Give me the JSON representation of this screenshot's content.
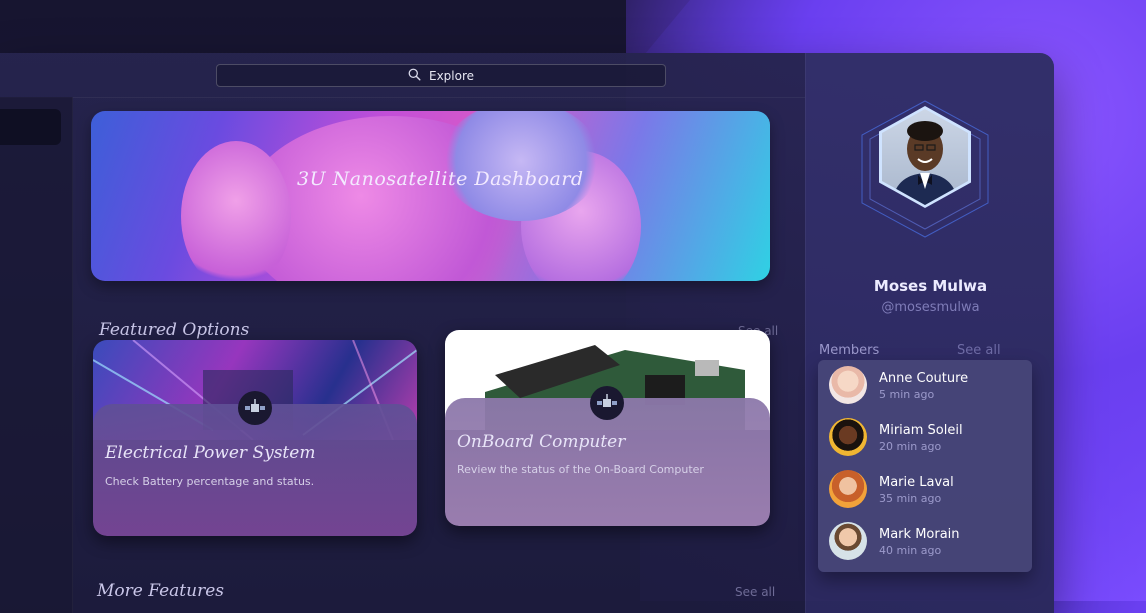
{
  "search": {
    "label": "Explore"
  },
  "hero": {
    "title": "3U Nanosatellite Dashboard"
  },
  "featured": {
    "title": "Featured Options",
    "see_all": "See all",
    "cards": [
      {
        "title": "Electrical Power System",
        "subtitle": "Check Battery percentage and status.",
        "icon": "satellite-icon"
      },
      {
        "title": "OnBoard Computer",
        "subtitle": "Review the status of the On-Board Computer",
        "icon": "satellite-icon"
      }
    ]
  },
  "more": {
    "title": "More Features",
    "see_all": "See all"
  },
  "profile": {
    "name": "Moses Mulwa",
    "handle": "@mosesmulwa"
  },
  "members": {
    "title": "Members",
    "see_all": "See all",
    "items": [
      {
        "name": "Anne Couture",
        "time": "5 min ago"
      },
      {
        "name": "Miriam Soleil",
        "time": "20 min ago"
      },
      {
        "name": "Marie Laval",
        "time": "35 min ago"
      },
      {
        "name": "Mark  Morain",
        "time": "40 min ago"
      }
    ]
  },
  "colors": {
    "accent": "#7b4dff",
    "background": "#1c1a3f"
  }
}
